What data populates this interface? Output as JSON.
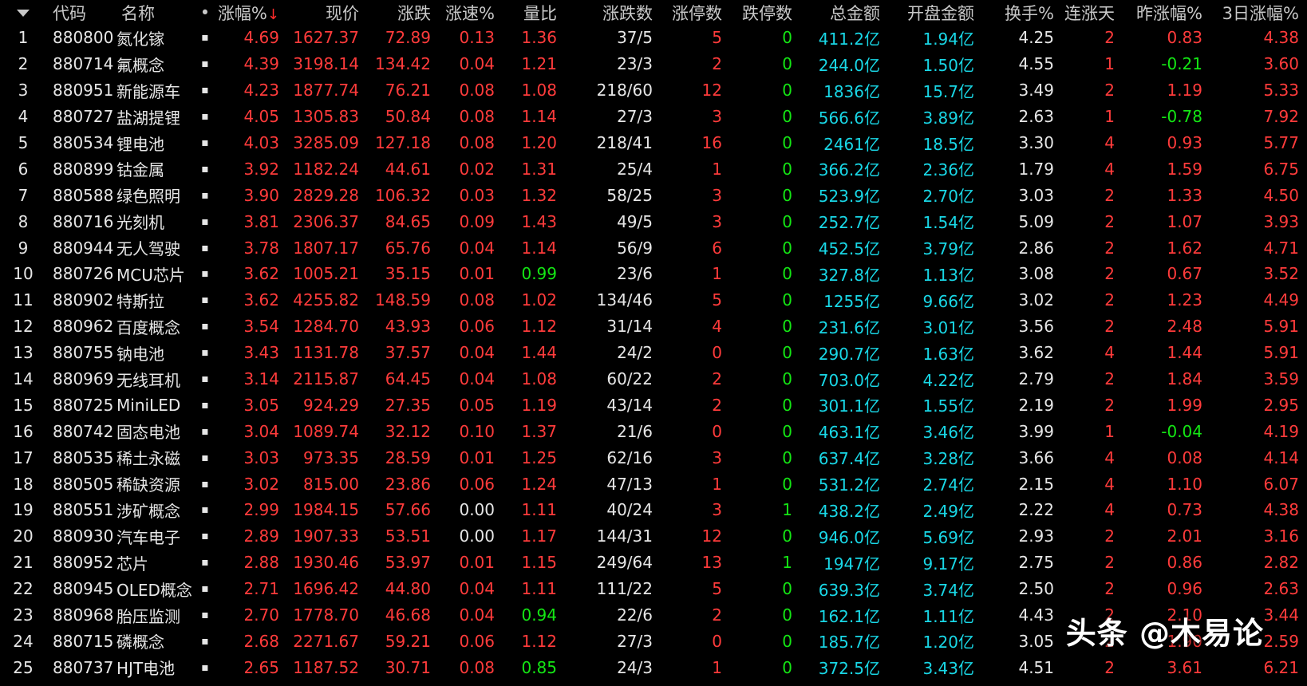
{
  "columns": [
    {
      "key": "collapse",
      "label": ""
    },
    {
      "key": "code",
      "label": "代码"
    },
    {
      "key": "name",
      "label": "名称"
    },
    {
      "key": "mark",
      "label": "•"
    },
    {
      "key": "pct",
      "label": "涨幅%",
      "sort": "↓"
    },
    {
      "key": "price",
      "label": "现价"
    },
    {
      "key": "change",
      "label": "涨跌"
    },
    {
      "key": "speed",
      "label": "涨速%"
    },
    {
      "key": "vr",
      "label": "量比"
    },
    {
      "key": "updown",
      "label": "涨跌数"
    },
    {
      "key": "limitup",
      "label": "涨停数"
    },
    {
      "key": "limitdown",
      "label": "跌停数"
    },
    {
      "key": "amount",
      "label": "总金额"
    },
    {
      "key": "openamt",
      "label": "开盘金额"
    },
    {
      "key": "turnover",
      "label": "换手%"
    },
    {
      "key": "days",
      "label": "连涨天"
    },
    {
      "key": "ypct",
      "label": "昨涨幅%"
    },
    {
      "key": "pct3",
      "label": "3日涨幅%"
    }
  ],
  "colors": {
    "up": "#ff3b3b",
    "down": "#14e614",
    "flat": "#e6e6e6",
    "amount": "#19d7e6"
  },
  "rows": [
    {
      "idx": "1",
      "code": "880800",
      "name": "氮化镓",
      "mark": "▪",
      "pct": "4.69",
      "price": "1627.37",
      "change": "72.89",
      "speed": "0.13",
      "vr": "1.36",
      "updown": "37/5",
      "limitup": "5",
      "limitdown": "0",
      "amount": "411.2亿",
      "openamt": "1.94亿",
      "turnover": "4.25",
      "days": "2",
      "ypct": "0.83",
      "pct3": "4.38"
    },
    {
      "idx": "2",
      "code": "880714",
      "name": "氟概念",
      "mark": "▪",
      "pct": "4.39",
      "price": "3198.14",
      "change": "134.42",
      "speed": "0.04",
      "vr": "1.21",
      "updown": "23/3",
      "limitup": "2",
      "limitdown": "0",
      "amount": "244.0亿",
      "openamt": "1.50亿",
      "turnover": "4.55",
      "days": "1",
      "ypct": "-0.21",
      "pct3": "3.60"
    },
    {
      "idx": "3",
      "code": "880951",
      "name": "新能源车",
      "mark": "▪",
      "pct": "4.23",
      "price": "1877.74",
      "change": "76.21",
      "speed": "0.08",
      "vr": "1.08",
      "updown": "218/60",
      "limitup": "12",
      "limitdown": "0",
      "amount": "1836亿",
      "openamt": "15.7亿",
      "turnover": "3.49",
      "days": "2",
      "ypct": "1.19",
      "pct3": "5.33"
    },
    {
      "idx": "4",
      "code": "880727",
      "name": "盐湖提锂",
      "mark": "▪",
      "pct": "4.05",
      "price": "1305.83",
      "change": "50.84",
      "speed": "0.08",
      "vr": "1.14",
      "updown": "27/3",
      "limitup": "3",
      "limitdown": "0",
      "amount": "566.6亿",
      "openamt": "3.89亿",
      "turnover": "2.63",
      "days": "1",
      "ypct": "-0.78",
      "pct3": "7.92"
    },
    {
      "idx": "5",
      "code": "880534",
      "name": "锂电池",
      "mark": "▪",
      "pct": "4.03",
      "price": "3285.09",
      "change": "127.18",
      "speed": "0.08",
      "vr": "1.20",
      "updown": "218/41",
      "limitup": "16",
      "limitdown": "0",
      "amount": "2461亿",
      "openamt": "18.5亿",
      "turnover": "3.30",
      "days": "4",
      "ypct": "0.93",
      "pct3": "5.77"
    },
    {
      "idx": "6",
      "code": "880899",
      "name": "钴金属",
      "mark": "▪",
      "pct": "3.92",
      "price": "1182.24",
      "change": "44.61",
      "speed": "0.02",
      "vr": "1.31",
      "updown": "25/4",
      "limitup": "1",
      "limitdown": "0",
      "amount": "366.2亿",
      "openamt": "2.36亿",
      "turnover": "1.79",
      "days": "4",
      "ypct": "1.59",
      "pct3": "6.75"
    },
    {
      "idx": "7",
      "code": "880588",
      "name": "绿色照明",
      "mark": "▪",
      "pct": "3.90",
      "price": "2829.28",
      "change": "106.32",
      "speed": "0.03",
      "vr": "1.32",
      "updown": "58/25",
      "limitup": "3",
      "limitdown": "0",
      "amount": "523.9亿",
      "openamt": "2.70亿",
      "turnover": "3.03",
      "days": "2",
      "ypct": "1.33",
      "pct3": "4.50"
    },
    {
      "idx": "8",
      "code": "880716",
      "name": "光刻机",
      "mark": "▪",
      "pct": "3.81",
      "price": "2306.37",
      "change": "84.65",
      "speed": "0.09",
      "vr": "1.43",
      "updown": "49/5",
      "limitup": "3",
      "limitdown": "0",
      "amount": "252.7亿",
      "openamt": "1.54亿",
      "turnover": "5.09",
      "days": "2",
      "ypct": "1.07",
      "pct3": "3.93"
    },
    {
      "idx": "9",
      "code": "880944",
      "name": "无人驾驶",
      "mark": "▪",
      "pct": "3.78",
      "price": "1807.17",
      "change": "65.76",
      "speed": "0.04",
      "vr": "1.14",
      "updown": "56/9",
      "limitup": "6",
      "limitdown": "0",
      "amount": "452.5亿",
      "openamt": "3.79亿",
      "turnover": "2.86",
      "days": "2",
      "ypct": "1.62",
      "pct3": "4.71"
    },
    {
      "idx": "10",
      "code": "880726",
      "name": "MCU芯片",
      "mark": "▪",
      "pct": "3.62",
      "price": "1005.21",
      "change": "35.15",
      "speed": "0.01",
      "vr": "0.99",
      "updown": "23/6",
      "limitup": "1",
      "limitdown": "0",
      "amount": "327.8亿",
      "openamt": "1.13亿",
      "turnover": "3.08",
      "days": "2",
      "ypct": "0.67",
      "pct3": "3.52"
    },
    {
      "idx": "11",
      "code": "880902",
      "name": "特斯拉",
      "mark": "▪",
      "pct": "3.62",
      "price": "4255.82",
      "change": "148.59",
      "speed": "0.08",
      "vr": "1.02",
      "updown": "134/46",
      "limitup": "5",
      "limitdown": "0",
      "amount": "1255亿",
      "openamt": "9.66亿",
      "turnover": "3.02",
      "days": "2",
      "ypct": "1.23",
      "pct3": "4.49"
    },
    {
      "idx": "12",
      "code": "880962",
      "name": "百度概念",
      "mark": "▪",
      "pct": "3.54",
      "price": "1284.70",
      "change": "43.93",
      "speed": "0.06",
      "vr": "1.12",
      "updown": "31/14",
      "limitup": "4",
      "limitdown": "0",
      "amount": "231.6亿",
      "openamt": "3.01亿",
      "turnover": "3.56",
      "days": "2",
      "ypct": "2.48",
      "pct3": "5.91"
    },
    {
      "idx": "13",
      "code": "880755",
      "name": "钠电池",
      "mark": "▪",
      "pct": "3.43",
      "price": "1131.78",
      "change": "37.57",
      "speed": "0.04",
      "vr": "1.44",
      "updown": "24/2",
      "limitup": "0",
      "limitdown": "0",
      "amount": "290.7亿",
      "openamt": "1.63亿",
      "turnover": "3.62",
      "days": "4",
      "ypct": "1.44",
      "pct3": "5.91"
    },
    {
      "idx": "14",
      "code": "880969",
      "name": "无线耳机",
      "mark": "▪",
      "pct": "3.14",
      "price": "2115.87",
      "change": "64.45",
      "speed": "0.04",
      "vr": "1.08",
      "updown": "60/22",
      "limitup": "2",
      "limitdown": "0",
      "amount": "703.0亿",
      "openamt": "4.22亿",
      "turnover": "2.79",
      "days": "2",
      "ypct": "1.84",
      "pct3": "3.59"
    },
    {
      "idx": "15",
      "code": "880725",
      "name": "MiniLED",
      "mark": "▪",
      "pct": "3.05",
      "price": "924.29",
      "change": "27.35",
      "speed": "0.05",
      "vr": "1.19",
      "updown": "43/14",
      "limitup": "2",
      "limitdown": "0",
      "amount": "301.1亿",
      "openamt": "1.55亿",
      "turnover": "2.19",
      "days": "2",
      "ypct": "1.99",
      "pct3": "2.95"
    },
    {
      "idx": "16",
      "code": "880742",
      "name": "固态电池",
      "mark": "▪",
      "pct": "3.04",
      "price": "1089.74",
      "change": "32.12",
      "speed": "0.10",
      "vr": "1.37",
      "updown": "21/6",
      "limitup": "0",
      "limitdown": "0",
      "amount": "463.1亿",
      "openamt": "3.46亿",
      "turnover": "3.99",
      "days": "1",
      "ypct": "-0.04",
      "pct3": "4.19"
    },
    {
      "idx": "17",
      "code": "880535",
      "name": "稀土永磁",
      "mark": "▪",
      "pct": "3.03",
      "price": "973.35",
      "change": "28.59",
      "speed": "0.01",
      "vr": "1.25",
      "updown": "62/16",
      "limitup": "3",
      "limitdown": "0",
      "amount": "637.4亿",
      "openamt": "3.28亿",
      "turnover": "3.66",
      "days": "4",
      "ypct": "0.08",
      "pct3": "4.14"
    },
    {
      "idx": "18",
      "code": "880505",
      "name": "稀缺资源",
      "mark": "▪",
      "pct": "3.02",
      "price": "815.00",
      "change": "23.86",
      "speed": "0.06",
      "vr": "1.24",
      "updown": "47/13",
      "limitup": "1",
      "limitdown": "0",
      "amount": "531.2亿",
      "openamt": "2.74亿",
      "turnover": "2.15",
      "days": "4",
      "ypct": "1.10",
      "pct3": "6.07"
    },
    {
      "idx": "19",
      "code": "880551",
      "name": "涉矿概念",
      "mark": "▪",
      "pct": "2.99",
      "price": "1984.15",
      "change": "57.66",
      "speed": "0.00",
      "vr": "1.11",
      "updown": "40/24",
      "limitup": "3",
      "limitdown": "1",
      "amount": "438.2亿",
      "openamt": "2.49亿",
      "turnover": "2.22",
      "days": "4",
      "ypct": "0.73",
      "pct3": "4.38"
    },
    {
      "idx": "20",
      "code": "880930",
      "name": "汽车电子",
      "mark": "▪",
      "pct": "2.89",
      "price": "1907.33",
      "change": "53.51",
      "speed": "0.00",
      "vr": "1.17",
      "updown": "144/31",
      "limitup": "12",
      "limitdown": "0",
      "amount": "946.0亿",
      "openamt": "5.69亿",
      "turnover": "2.93",
      "days": "2",
      "ypct": "2.01",
      "pct3": "3.16"
    },
    {
      "idx": "21",
      "code": "880952",
      "name": "芯片",
      "mark": "▪",
      "pct": "2.88",
      "price": "1930.46",
      "change": "53.97",
      "speed": "0.01",
      "vr": "1.15",
      "updown": "249/64",
      "limitup": "13",
      "limitdown": "1",
      "amount": "1947亿",
      "openamt": "9.17亿",
      "turnover": "2.75",
      "days": "2",
      "ypct": "0.86",
      "pct3": "2.82"
    },
    {
      "idx": "22",
      "code": "880945",
      "name": "OLED概念",
      "mark": "▪",
      "pct": "2.71",
      "price": "1696.42",
      "change": "44.80",
      "speed": "0.04",
      "vr": "1.11",
      "updown": "111/22",
      "limitup": "5",
      "limitdown": "0",
      "amount": "639.3亿",
      "openamt": "3.74亿",
      "turnover": "2.50",
      "days": "2",
      "ypct": "0.96",
      "pct3": "2.63"
    },
    {
      "idx": "23",
      "code": "880968",
      "name": "胎压监测",
      "mark": "▪",
      "pct": "2.70",
      "price": "1778.70",
      "change": "46.68",
      "speed": "0.04",
      "vr": "0.94",
      "updown": "22/6",
      "limitup": "2",
      "limitdown": "0",
      "amount": "162.1亿",
      "openamt": "1.11亿",
      "turnover": "4.43",
      "days": "2",
      "ypct": "2.10",
      "pct3": "3.44"
    },
    {
      "idx": "24",
      "code": "880715",
      "name": "磷概念",
      "mark": "▪",
      "pct": "2.68",
      "price": "2271.67",
      "change": "59.21",
      "speed": "0.06",
      "vr": "1.12",
      "updown": "27/3",
      "limitup": "0",
      "limitdown": "0",
      "amount": "185.7亿",
      "openamt": "1.20亿",
      "turnover": "3.05",
      "days": "2",
      "ypct": "1.90",
      "pct3": "2.59"
    },
    {
      "idx": "25",
      "code": "880737",
      "name": "HJT电池",
      "mark": "▪",
      "pct": "2.65",
      "price": "1187.52",
      "change": "30.71",
      "speed": "0.08",
      "vr": "0.85",
      "updown": "24/3",
      "limitup": "1",
      "limitdown": "0",
      "amount": "372.5亿",
      "openamt": "3.43亿",
      "turnover": "4.51",
      "days": "2",
      "ypct": "3.61",
      "pct3": "6.21"
    }
  ],
  "watermark": "头条 @木易论"
}
